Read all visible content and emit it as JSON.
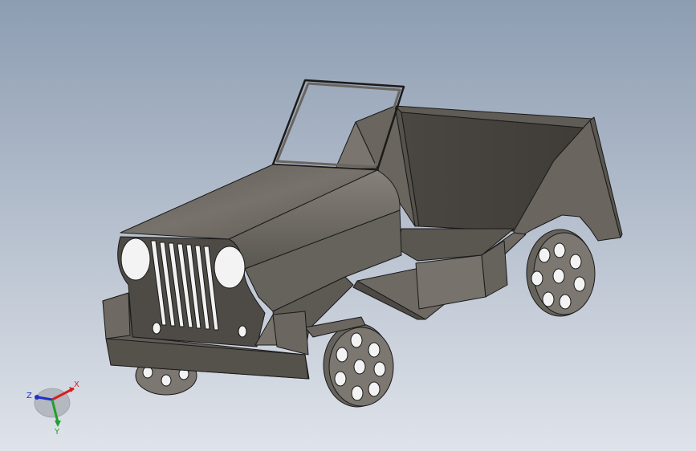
{
  "viewport": {
    "background_top": "#8d9db2",
    "background_bottom": "#dfe3ea"
  },
  "model": {
    "body_color": "#6a655e",
    "body_dark": "#4a4641",
    "body_light": "#85807a",
    "edge_color": "#1a1a1a"
  },
  "triad": {
    "x_label": "X",
    "y_label": "Y",
    "z_label": "Z",
    "x_color": "#d42020",
    "y_color": "#1fa02a",
    "z_color": "#2030c8"
  }
}
